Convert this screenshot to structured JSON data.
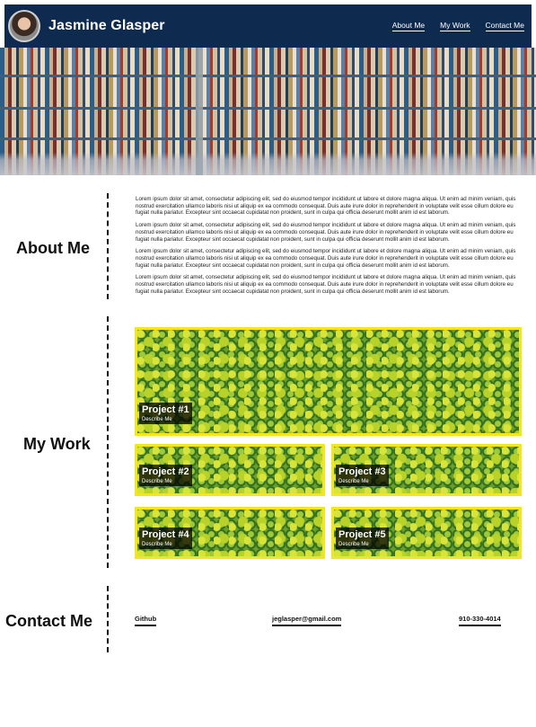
{
  "header": {
    "name": "Jasmine Glasper",
    "nav": [
      "About Me",
      "My Work",
      "Contact Me"
    ]
  },
  "sections": {
    "about": "About Me",
    "work": "My Work",
    "contact": "Contact Me"
  },
  "about": {
    "paragraphs": [
      "Lorem ipsum dolor sit amet, consectetur adipiscing elit, sed do eiusmod tempor incididunt ut labore et dolore magna aliqua. Ut enim ad minim veniam, quis nostrud exercitation ullamco laboris nisi ut aliquip ex ea commodo consequat. Duis aute irure dolor in reprehenderit in voluptate velit esse cillum dolore eu fugiat nulla pariatur. Excepteur sint occaecat cupidatat non proident, sunt in culpa qui officia deserunt mollit anim id est laborum.",
      "Lorem ipsum dolor sit amet, consectetur adipiscing elit, sed do eiusmod tempor incididunt ut labore et dolore magna aliqua. Ut enim ad minim veniam, quis nostrud exercitation ullamco laboris nisi ut aliquip ex ea commodo consequat. Duis aute irure dolor in reprehenderit in voluptate velit esse cillum dolore eu fugiat nulla pariatur. Excepteur sint occaecat cupidatat non proident, sunt in culpa qui officia deserunt mollit anim id est laborum.",
      "Lorem ipsum dolor sit amet, consectetur adipiscing elit, sed do eiusmod tempor incididunt ut labore et dolore magna aliqua. Ut enim ad minim veniam, quis nostrud exercitation ullamco laboris nisi ut aliquip ex ea commodo consequat. Duis aute irure dolor in reprehenderit in voluptate velit esse cillum dolore eu fugiat nulla pariatur. Excepteur sint occaecat cupidatat non proident, sunt in culpa qui officia deserunt mollit anim id est laborum.",
      "Lorem ipsum dolor sit amet, consectetur adipiscing elit, sed do eiusmod tempor incididunt ut labore et dolore magna aliqua. Ut enim ad minim veniam, quis nostrud exercitation ullamco laboris nisi ut aliquip ex ea commodo consequat. Duis aute irure dolor in reprehenderit in voluptate velit esse cillum dolore eu fugiat nulla pariatur. Excepteur sint occaecat cupidatat non proident, sunt in culpa qui officia deserunt mollit anim id est laborum."
    ]
  },
  "projects": [
    {
      "title": "Project #1",
      "desc": "Describe Me"
    },
    {
      "title": "Project #2",
      "desc": "Describe Me"
    },
    {
      "title": "Project #3",
      "desc": "Describe Me"
    },
    {
      "title": "Project #4",
      "desc": "Describe Me"
    },
    {
      "title": "Project #5",
      "desc": "Describe Me"
    }
  ],
  "contact": {
    "github": "Github",
    "email": "jeglasper@gmail.com",
    "phone": "910-330-4014"
  },
  "colors": {
    "header_bg": "#0e2a4f",
    "card_border": "#f3e61c"
  }
}
